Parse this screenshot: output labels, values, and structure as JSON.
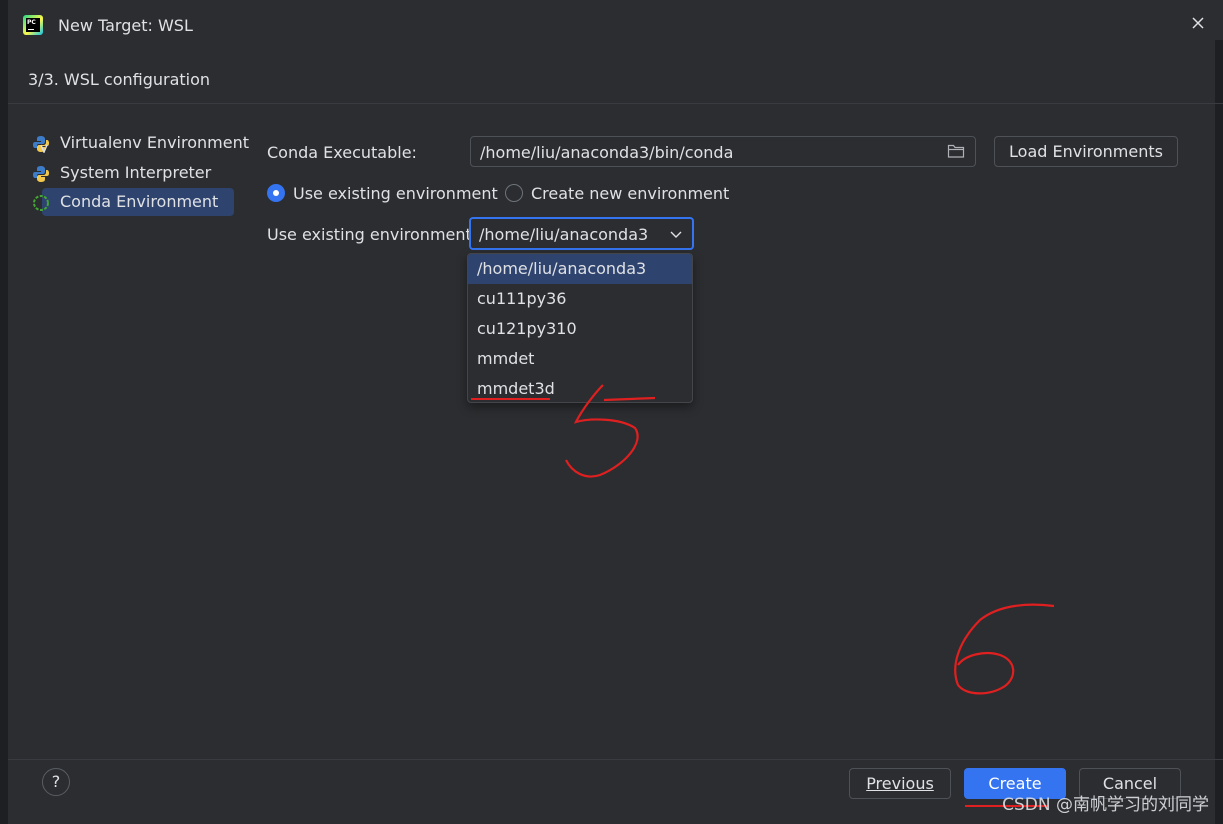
{
  "window": {
    "title": "New Target: WSL"
  },
  "step": {
    "title": "3/3. WSL configuration"
  },
  "sidebar": {
    "items": [
      {
        "label": "Virtualenv Environment",
        "icon": "python-venv-icon"
      },
      {
        "label": "System Interpreter",
        "icon": "python-icon"
      },
      {
        "label": "Conda Environment",
        "icon": "conda-icon",
        "selected": true
      }
    ]
  },
  "form": {
    "conda_executable_label": "Conda Executable:",
    "conda_executable_value": "/home/liu/anaconda3/bin/conda",
    "load_env_button": "Load Environments",
    "radio_existing_label": "Use existing environment",
    "radio_new_label": "Create new environment",
    "radio_selected": "existing",
    "existing_env_label": "Use existing environment:",
    "existing_env_value": "/home/liu/anaconda3",
    "dropdown_options": [
      "/home/liu/anaconda3",
      "cu111py36",
      "cu121py310",
      "mmdet",
      "mmdet3d"
    ],
    "dropdown_highlighted": "/home/liu/anaconda3"
  },
  "footer": {
    "help_label": "?",
    "previous_button": "Previous",
    "create_button": "Create",
    "cancel_button": "Cancel"
  },
  "annotations": {
    "mark_5": "5",
    "mark_6": "6",
    "color": "#e02020"
  },
  "watermark": "CSDN @南帆学习的刘同学",
  "colors": {
    "background": "#2b2d30",
    "accent": "#3574f0",
    "selection": "#2e436e",
    "text": "#dfe1e5"
  }
}
